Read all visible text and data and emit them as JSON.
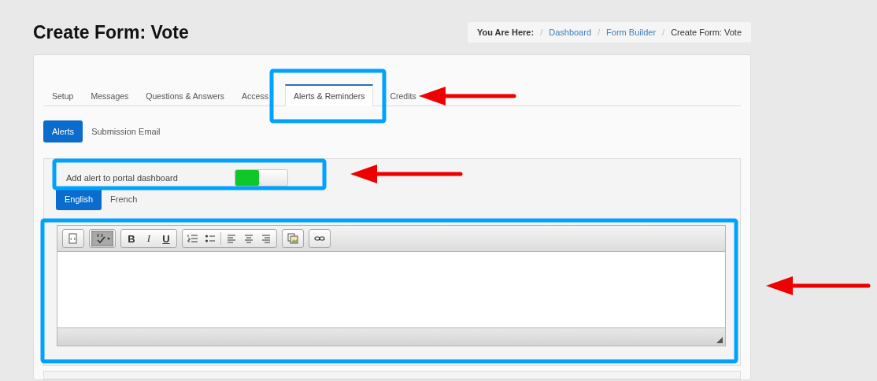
{
  "page_title": "Create Form: Vote",
  "breadcrumb": {
    "label": "You Are Here:",
    "items": [
      {
        "separator": "/",
        "text": "Dashboard",
        "link": true
      },
      {
        "separator": "/",
        "text": "Form Builder",
        "link": true
      },
      {
        "separator": "/",
        "text": "Create Form: Vote",
        "link": false
      }
    ]
  },
  "tabs": [
    {
      "label": "Setup",
      "selected": false
    },
    {
      "label": "Messages",
      "selected": false
    },
    {
      "label": "Questions & Answers",
      "selected": false
    },
    {
      "label": "Access",
      "selected": false
    },
    {
      "label": "Alerts & Reminders",
      "selected": true
    },
    {
      "label": "Credits",
      "selected": false
    }
  ],
  "subtabs": [
    {
      "label": "Alerts",
      "selected": true
    },
    {
      "label": "Submission Email",
      "selected": false
    }
  ],
  "alert_toggle": {
    "label": "Add alert to portal dashboard",
    "on": true
  },
  "languages": [
    {
      "label": "English",
      "selected": true
    },
    {
      "label": "French",
      "selected": false
    }
  ],
  "toolbar": [
    [
      {
        "kind": "source",
        "pressed": false
      }
    ],
    [
      {
        "kind": "spellcheck",
        "pressed": true
      }
    ],
    [
      {
        "kind": "bold",
        "text": "B",
        "pressed": false
      },
      {
        "kind": "italic",
        "text": "I",
        "pressed": false
      },
      {
        "kind": "underline",
        "text": "U",
        "pressed": false
      }
    ],
    [
      {
        "kind": "numbered-list",
        "pressed": false
      },
      {
        "kind": "bulleted-list",
        "pressed": false
      },
      {
        "kind": "separator"
      },
      {
        "kind": "align-left",
        "pressed": false
      },
      {
        "kind": "align-center",
        "pressed": false
      },
      {
        "kind": "align-right",
        "pressed": false
      }
    ],
    [
      {
        "kind": "image",
        "pressed": false
      }
    ],
    [
      {
        "kind": "link",
        "pressed": false
      }
    ]
  ]
}
